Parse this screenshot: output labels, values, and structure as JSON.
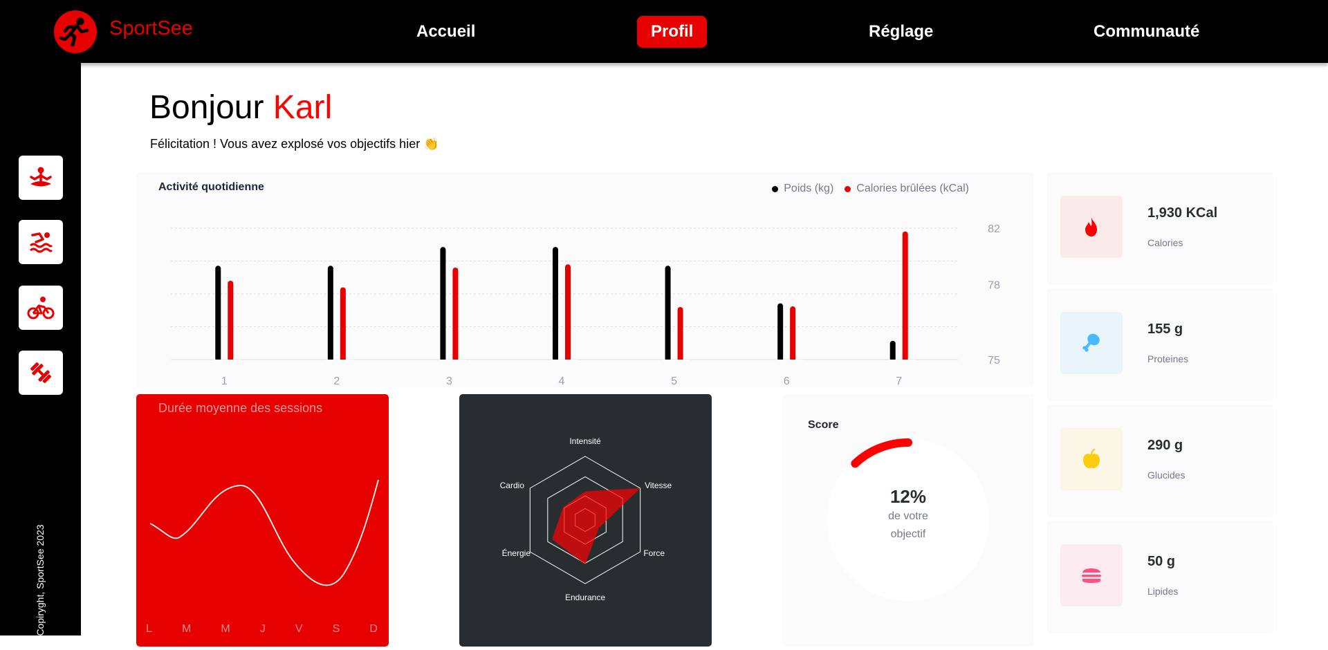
{
  "brand": {
    "name": "SportSee"
  },
  "nav": {
    "home": "Accueil",
    "profile": "Profil",
    "settings": "Réglage",
    "community": "Communauté"
  },
  "sidebar": {
    "icons": [
      "yoga-icon",
      "swimming-icon",
      "cycling-icon",
      "dumbbell-icon"
    ],
    "copyright": "Copiryght, SportSee 2023"
  },
  "greeting": {
    "hello": "Bonjour",
    "name": "Karl",
    "message": "Félicitation ! Vous avez explosé vos objectifs hier 👏"
  },
  "colors": {
    "accent": "#e60000",
    "dark": "#282d30",
    "black": "#000000"
  },
  "activity": {
    "title": "Activité quotidienne",
    "legend_weight": "Poids (kg)",
    "legend_calories": "Calories brûlées (kCal)"
  },
  "sessions": {
    "title": "Durée moyenne des sessions"
  },
  "score": {
    "title": "Score",
    "value": "12%",
    "label_line1": "de votre",
    "label_line2": "objectif"
  },
  "key_data": [
    {
      "value": "1,930 KCal",
      "label": "Calories",
      "icon": "flame-icon"
    },
    {
      "value": "155 g",
      "label": "Proteines",
      "icon": "chicken-icon"
    },
    {
      "value": "290 g",
      "label": "Glucides",
      "icon": "apple-icon"
    },
    {
      "value": "50 g",
      "label": "Lipides",
      "icon": "burger-icon"
    }
  ],
  "chart_data": [
    {
      "type": "bar",
      "title": "Activité quotidienne",
      "categories": [
        "1",
        "2",
        "3",
        "4",
        "5",
        "6",
        "7"
      ],
      "series": [
        {
          "name": "Poids (kg)",
          "values": [
            80,
            80,
            81,
            81,
            80,
            78,
            76
          ],
          "color": "#000000"
        },
        {
          "name": "Calories brûlées (kCal)",
          "values": [
            240,
            220,
            280,
            290,
            160,
            162,
            390
          ],
          "color": "#e60000"
        }
      ],
      "yticks": [
        "75",
        "78",
        "82"
      ],
      "ylim_weight": [
        75,
        82
      ],
      "ylim_calories": [
        0,
        400
      ]
    },
    {
      "type": "line",
      "title": "Durée moyenne des sessions",
      "categories": [
        "L",
        "M",
        "M",
        "J",
        "V",
        "S",
        "D"
      ],
      "values": [
        30,
        23,
        45,
        50,
        0,
        0,
        60
      ]
    },
    {
      "type": "radar",
      "categories": [
        "Intensité",
        "Vitesse",
        "Force",
        "Endurance",
        "Énergie",
        "Cardio"
      ],
      "values": [
        90,
        200,
        50,
        140,
        120,
        80
      ],
      "max": 200
    },
    {
      "type": "pie",
      "title": "Score",
      "value": 0.12
    }
  ]
}
